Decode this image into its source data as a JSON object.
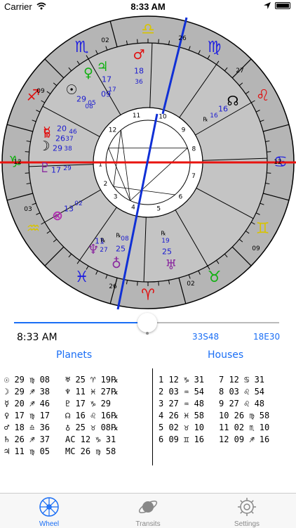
{
  "status_bar": {
    "carrier": "Carrier",
    "time": "8:33 AM"
  },
  "controls": {
    "time": "8:33 AM",
    "latitude": "33S48",
    "longitude": "18E30"
  },
  "tables": {
    "planets_header": "Planets",
    "houses_header": "Houses",
    "planets_left": [
      "☉ 29 ♍ 08",
      "☽ 29 ♐ 38",
      "☿ 20 ♐ 46",
      "♀ 17 ♍ 17",
      "♂ 18 ♎ 36",
      "♄ 26 ♐ 37",
      "♃ 11 ♍ 05"
    ],
    "planets_right": [
      "♅ 25 ♈ 19℞",
      "♆ 11 ♓ 27℞",
      "♇ 17 ♑ 29",
      "☊ 16 ♌ 16℞",
      "♁ 25 ♉ 08℞",
      "AC 12 ♑ 31",
      "MC 26 ♍ 58"
    ],
    "houses_left": [
      "1 12 ♑ 31",
      "2 03 ♒ 54",
      "3 27 ♒ 48",
      "4 26 ♓ 58",
      "5 02 ♉ 10",
      "6 09 ♊ 16"
    ],
    "houses_right": [
      "7 12 ♋ 31",
      "8 03 ♌ 54",
      "9 27 ♌ 48",
      "10 26 ♍ 58",
      "11 02 ♏ 10",
      "12 09 ♐ 16"
    ]
  },
  "tabs": [
    {
      "label": "Wheel",
      "icon": "wheel-icon",
      "active": true
    },
    {
      "label": "Transits",
      "icon": "planet-icon",
      "active": false
    },
    {
      "label": "Settings",
      "icon": "gear-icon",
      "active": false
    }
  ],
  "colors": {
    "accent": "#1a6ef5",
    "ring": "#b5b5b5",
    "axis_red": "#e8130f",
    "axis_blue": "#1030d6"
  },
  "wheel": {
    "signs": [
      {
        "name": "Libra",
        "glyph": "♎",
        "color": "#d8c400"
      },
      {
        "name": "Virgo",
        "glyph": "♍",
        "color": "#2020e0"
      },
      {
        "name": "Leo",
        "glyph": "♌",
        "color": "#e01010"
      },
      {
        "name": "Cancer",
        "glyph": "♋",
        "color": "#2020e0"
      },
      {
        "name": "Gemini",
        "glyph": "♊",
        "color": "#d8c400"
      },
      {
        "name": "Taurus",
        "glyph": "♉",
        "color": "#10b010"
      },
      {
        "name": "Aries",
        "glyph": "♈",
        "color": "#e01010"
      },
      {
        "name": "Pisces",
        "glyph": "♓",
        "color": "#2020e0"
      },
      {
        "name": "Aquarius",
        "glyph": "♒",
        "color": "#d8c400"
      },
      {
        "name": "Capricorn",
        "glyph": "♑",
        "color": "#10b010"
      },
      {
        "name": "Sagittarius",
        "glyph": "♐",
        "color": "#e01010"
      },
      {
        "name": "Scorpio",
        "glyph": "♏",
        "color": "#2020e0"
      }
    ],
    "cusp_labels": [
      "26",
      "27",
      "12",
      "09",
      "02",
      "26",
      "03",
      "12",
      "09",
      "02"
    ],
    "house_numbers": [
      "1",
      "2",
      "3",
      "4",
      "5",
      "6",
      "7",
      "8",
      "9",
      "10",
      "11",
      "12"
    ],
    "planets": [
      {
        "name": "Mars",
        "glyph": "♂",
        "deg": "18",
        "min": "36",
        "color": "#e01010"
      },
      {
        "name": "Venus",
        "glyph": "♀",
        "deg": "17",
        "min": "17",
        "color": "#10b010"
      },
      {
        "name": "Jupiter",
        "glyph": "♃",
        "deg": "09",
        "min": "05",
        "color": "#10b010"
      },
      {
        "name": "Sun",
        "glyph": "☉",
        "deg": "29",
        "min": "08",
        "color": "#000000"
      },
      {
        "name": "North Node",
        "glyph": "☊",
        "deg": "16",
        "min": "16",
        "color": "#000000"
      },
      {
        "name": "Mercury",
        "glyph": "☿",
        "deg": "20",
        "min": "46",
        "color": "#e01010"
      },
      {
        "name": "Saturn",
        "glyph": "♄",
        "deg": "26",
        "min": "37",
        "color": "#e01010"
      },
      {
        "name": "Moon",
        "glyph": "☽",
        "deg": "29",
        "min": "38",
        "color": "#000000"
      },
      {
        "name": "Pluto",
        "glyph": "♇",
        "deg": "17",
        "min": "29",
        "color": "#8a2aa0"
      },
      {
        "name": "Part of Fortune",
        "glyph": "⊗",
        "deg": "13",
        "min": "02",
        "color": "#b030b0"
      },
      {
        "name": "Neptune",
        "glyph": "♆",
        "deg": "11",
        "min": "27",
        "color": "#8a2aa0"
      },
      {
        "name": "Earth",
        "glyph": "♁",
        "deg": "25",
        "min": "08",
        "color": "#8a2aa0"
      },
      {
        "name": "Uranus",
        "glyph": "♅",
        "deg": "25",
        "min": "19",
        "color": "#8a2aa0"
      }
    ],
    "retrograde": "℞"
  }
}
